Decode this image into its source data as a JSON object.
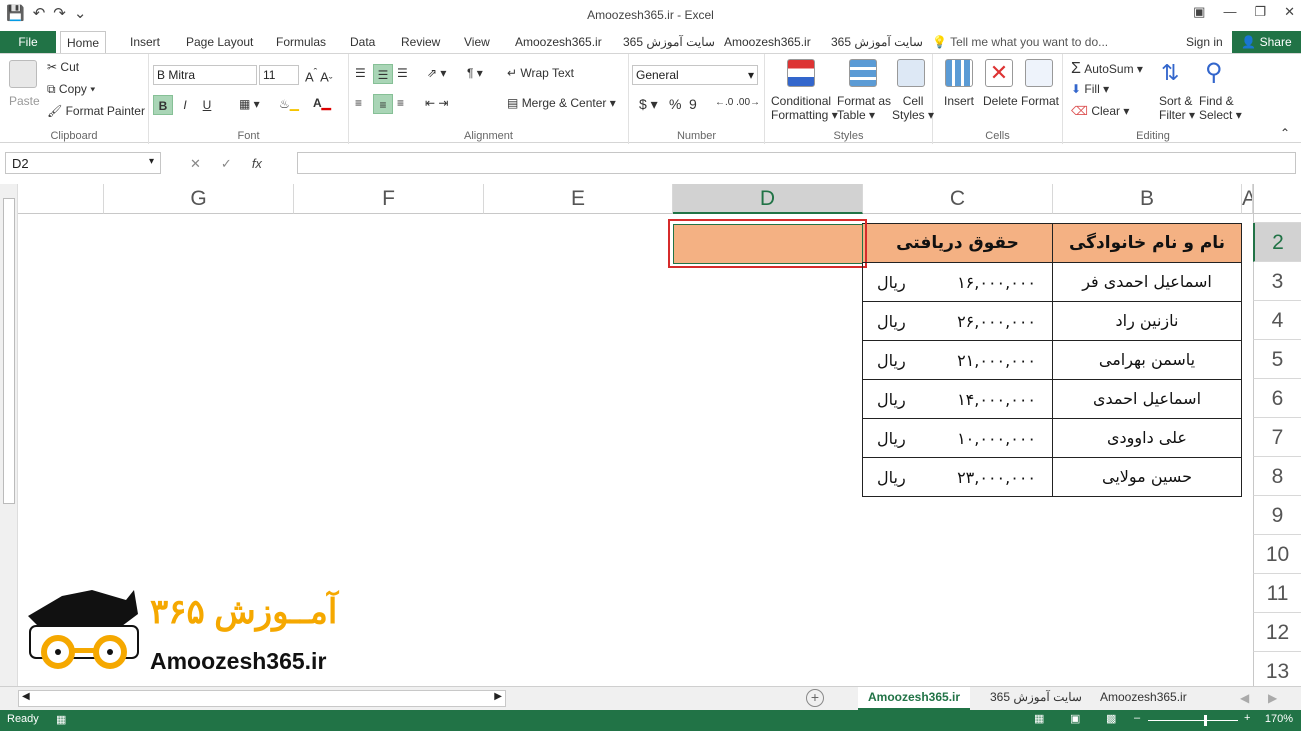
{
  "window": {
    "title": "Amoozesh365.ir - Excel",
    "qat": [
      "save-icon",
      "undo-icon",
      "redo-icon",
      "customize-icon"
    ],
    "controls": [
      "ribbon-display-icon",
      "minimize-icon",
      "restore-icon",
      "close-icon"
    ]
  },
  "tabs": {
    "file": "File",
    "items": [
      "Home",
      "Insert",
      "Page Layout",
      "Formulas",
      "Data",
      "Review",
      "View",
      "Amoozesh365.ir",
      "سایت آموزش 365",
      "Amoozesh365.ir",
      "سایت آموزش 365"
    ],
    "tell": "Tell me what you want to do...",
    "signin": "Sign in",
    "share": "Share"
  },
  "ribbon": {
    "clipboard": {
      "label": "Clipboard",
      "paste": "Paste",
      "cut": "Cut",
      "copy": "Copy",
      "format_painter": "Format Painter"
    },
    "font": {
      "label": "Font",
      "name": "B Mitra",
      "size": "11",
      "bold": "B",
      "italic": "I",
      "underline": "U"
    },
    "alignment": {
      "label": "Alignment",
      "wrap": "Wrap Text",
      "merge": "Merge & Center"
    },
    "number": {
      "label": "Number",
      "format": "General",
      "currency": "$",
      "percent": "%",
      "comma": "9"
    },
    "styles": {
      "label": "Styles",
      "conditional_1": "Conditional",
      "conditional_2": "Formatting",
      "format_table_1": "Format as",
      "format_table_2": "Table",
      "cell_styles_1": "Cell",
      "cell_styles_2": "Styles"
    },
    "cells": {
      "label": "Cells",
      "insert": "Insert",
      "delete": "Delete",
      "format": "Format"
    },
    "editing": {
      "label": "Editing",
      "autosum": "AutoSum",
      "fill": "Fill",
      "clear": "Clear",
      "sort_1": "Sort &",
      "sort_2": "Filter",
      "find_1": "Find &",
      "find_2": "Select"
    }
  },
  "formula_bar": {
    "name_box": "D2",
    "cancel": "✕",
    "enter": "✓",
    "fx": "fx",
    "value": ""
  },
  "grid": {
    "columns": [
      "G",
      "F",
      "E",
      "D",
      "C",
      "B",
      "A"
    ],
    "rows": [
      "2",
      "3",
      "4",
      "5",
      "6",
      "7",
      "8",
      "9",
      "10",
      "11",
      "12",
      "13"
    ],
    "selected_column": "D",
    "selected_row": "2"
  },
  "table": {
    "headers": {
      "name": "نام و نام خانوادگی",
      "salary": "حقوق دریافتی"
    },
    "rows": [
      {
        "name": "اسماعیل احمدی فر",
        "amount": "۱۶,۰۰۰,۰۰۰",
        "unit": "ریال"
      },
      {
        "name": "نازنین راد",
        "amount": "۲۶,۰۰۰,۰۰۰",
        "unit": "ریال"
      },
      {
        "name": "یاسمن بهرامی",
        "amount": "۲۱,۰۰۰,۰۰۰",
        "unit": "ریال"
      },
      {
        "name": "اسماعیل احمدی",
        "amount": "۱۴,۰۰۰,۰۰۰",
        "unit": "ریال"
      },
      {
        "name": "علی داوودی",
        "amount": "۱۰,۰۰۰,۰۰۰",
        "unit": "ریال"
      },
      {
        "name": "حسین مولایی",
        "amount": "۲۳,۰۰۰,۰۰۰",
        "unit": "ریال"
      }
    ]
  },
  "logo": {
    "persian": "آمــوزش ۳۶۵",
    "url": "Amoozesh365.ir"
  },
  "sheets": {
    "tabs": [
      "Amoozesh365.ir",
      "سایت آموزش 365",
      "Amoozesh365.ir"
    ],
    "active": 0
  },
  "status": {
    "ready": "Ready",
    "zoom": "170%"
  },
  "colors": {
    "excel_green": "#217346",
    "header_fill": "#f4b183",
    "selection_border": "#d62b2b"
  }
}
